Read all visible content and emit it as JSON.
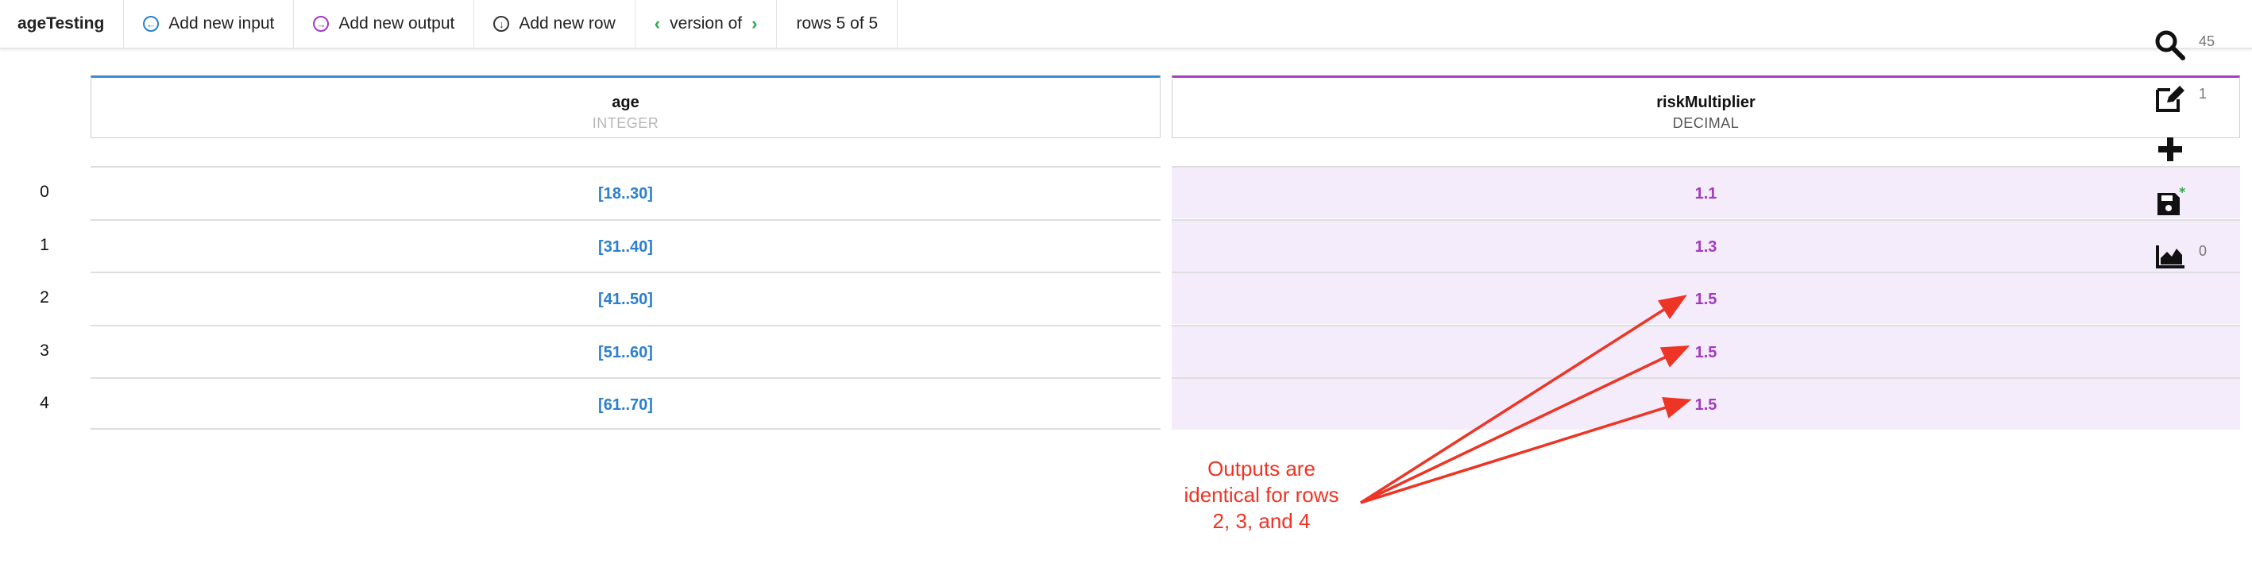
{
  "toolbar": {
    "title": "ageTesting",
    "add_input_label": "Add new input",
    "add_output_label": "Add new output",
    "add_row_label": "Add new row",
    "version_label": "version of",
    "rows_label": "rows 5 of 5"
  },
  "table": {
    "input_column": {
      "name": "age",
      "type": "INTEGER"
    },
    "output_column": {
      "name": "riskMultiplier",
      "type": "DECIMAL"
    },
    "rows": [
      {
        "index": "0",
        "input": "[18..30]",
        "output": "1.1"
      },
      {
        "index": "1",
        "input": "[31..40]",
        "output": "1.3"
      },
      {
        "index": "2",
        "input": "[41..50]",
        "output": "1.5"
      },
      {
        "index": "3",
        "input": "[51..60]",
        "output": "1.5"
      },
      {
        "index": "4",
        "input": "[61..70]",
        "output": "1.5"
      }
    ]
  },
  "side_panel": {
    "search_count": "45",
    "edit_count": "1",
    "chart_count": "0",
    "icons": [
      "search-icon",
      "edit-icon",
      "plus-icon",
      "save-icon",
      "area-chart-icon"
    ]
  },
  "annotation": {
    "lines": [
      "Outputs are",
      "identical for rows",
      "2, 3, and 4"
    ]
  },
  "colors": {
    "input_accent": "#2a7fd0",
    "output_accent": "#a23ac2",
    "output_bg": "#f5ecfb",
    "annotation": "#ee3424",
    "version_chevron": "#2aa84a"
  }
}
